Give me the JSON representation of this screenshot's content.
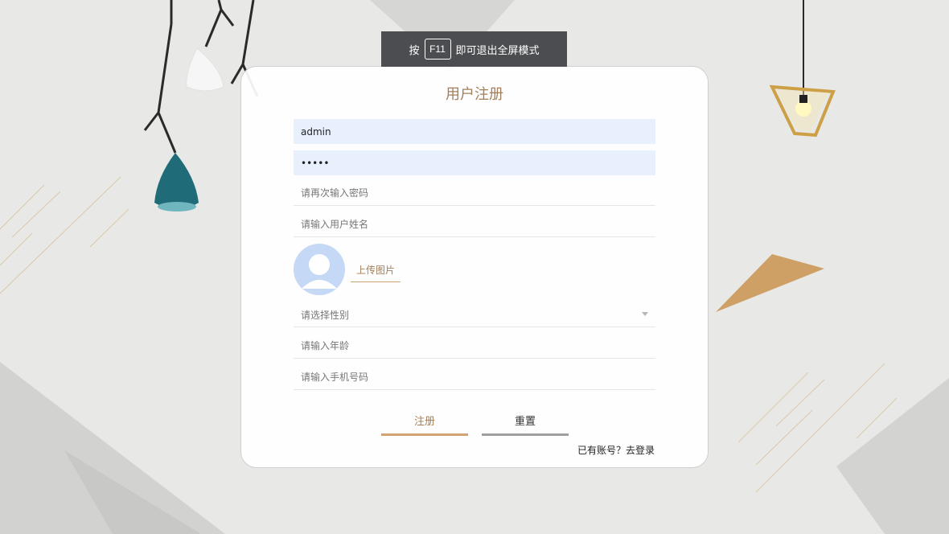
{
  "banner": {
    "prefix": "按",
    "key": "F11",
    "suffix": "即可退出全屏模式"
  },
  "form": {
    "title": "用户注册",
    "username_value": "admin",
    "password_value": "*****",
    "confirm_password_placeholder": "请再次输入密码",
    "name_placeholder": "请输入用户姓名",
    "upload_label": "上传图片",
    "gender_placeholder": "请选择性别",
    "age_placeholder": "请输入年龄",
    "phone_placeholder": "请输入手机号码",
    "register_label": "注册",
    "reset_label": "重置",
    "login_link": "已有账号？去登录"
  },
  "colors": {
    "accent": "#a47e58",
    "gold": "#d0a372",
    "avatar": "#c5d9f7",
    "autofill": "#e8f0fe"
  }
}
